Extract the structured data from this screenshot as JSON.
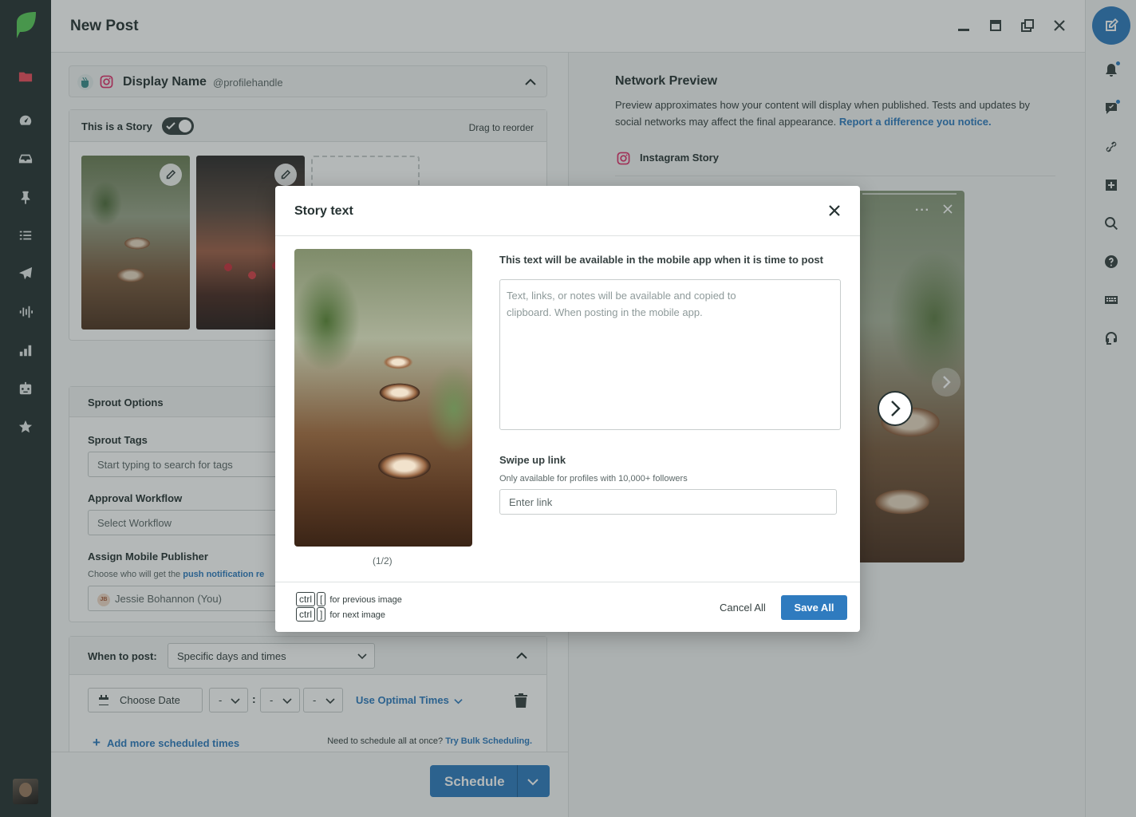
{
  "app": {
    "title": "New Post"
  },
  "colors": {
    "accent": "#2f7bbf",
    "nav_bg": "#273333",
    "active_icon": "#ed4c5c",
    "brand_green": "#59cb59"
  },
  "left_nav": {
    "items": [
      "folder-icon",
      "gauge-icon",
      "inbox-icon",
      "pin-icon",
      "list-icon",
      "send-icon",
      "listening-icon",
      "reports-icon",
      "bot-icon",
      "star-icon"
    ],
    "active": "folder-icon"
  },
  "right_nav": {
    "items": [
      "compose-icon",
      "bell-icon",
      "chat-icon",
      "link-icon",
      "plus-box-icon",
      "search-icon",
      "help-icon",
      "keyboard-icon",
      "headset-icon"
    ]
  },
  "profile": {
    "display_name": "Display Name",
    "handle": "@profilehandle"
  },
  "story": {
    "label": "This is a Story",
    "toggle_on": true,
    "drag_hint": "Drag to reorder"
  },
  "sprout_options": {
    "title": "Sprout Options",
    "tags_label": "Sprout Tags",
    "tags_placeholder": "Start typing to search for tags",
    "approval_label": "Approval Workflow",
    "approval_value": "Select Workflow",
    "publisher_label": "Assign Mobile Publisher",
    "publisher_sub": "Choose who will get the ",
    "publisher_sub_link": "push notification re",
    "publisher_initials": "JB",
    "publisher_value": "Jessie Bohannon (You)"
  },
  "when": {
    "label": "When to post:",
    "mode": "Specific days and times",
    "date_placeholder": "Choose Date",
    "hour": "-",
    "minute": "-",
    "ampm": "-",
    "colon": ":",
    "optimal": "Use Optimal Times",
    "add_more": "Add more scheduled times",
    "add_plus": "+",
    "bulk_text": "Need to schedule all at once?",
    "bulk_link": "Try Bulk Scheduling."
  },
  "footer": {
    "schedule_label": "Schedule"
  },
  "preview": {
    "title": "Network Preview",
    "description": "Preview approximates how your content will display when published. Tests and updates by social networks may affect the final appearance.",
    "description_link": "Report a difference you notice.",
    "network": "Instagram Story",
    "more": "···"
  },
  "modal": {
    "title": "Story text",
    "instruction": "This text will be available in the mobile app when it is time to post",
    "text_placeholder": "Text, links, or notes will be available and copied to\nclipboard. When posting in the mobile app.",
    "image_counter": "(1/2)",
    "swipe_label": "Swipe up link",
    "swipe_sub": "Only available for profiles with 10,000+ followers",
    "link_placeholder": "Enter link",
    "kbd_ctrl": "ctrl",
    "kbd_prev_key": "[",
    "kbd_next_key": "]",
    "prev_hint": "for previous image",
    "next_hint": "for next image",
    "cancel_label": "Cancel All",
    "save_label": "Save All"
  }
}
